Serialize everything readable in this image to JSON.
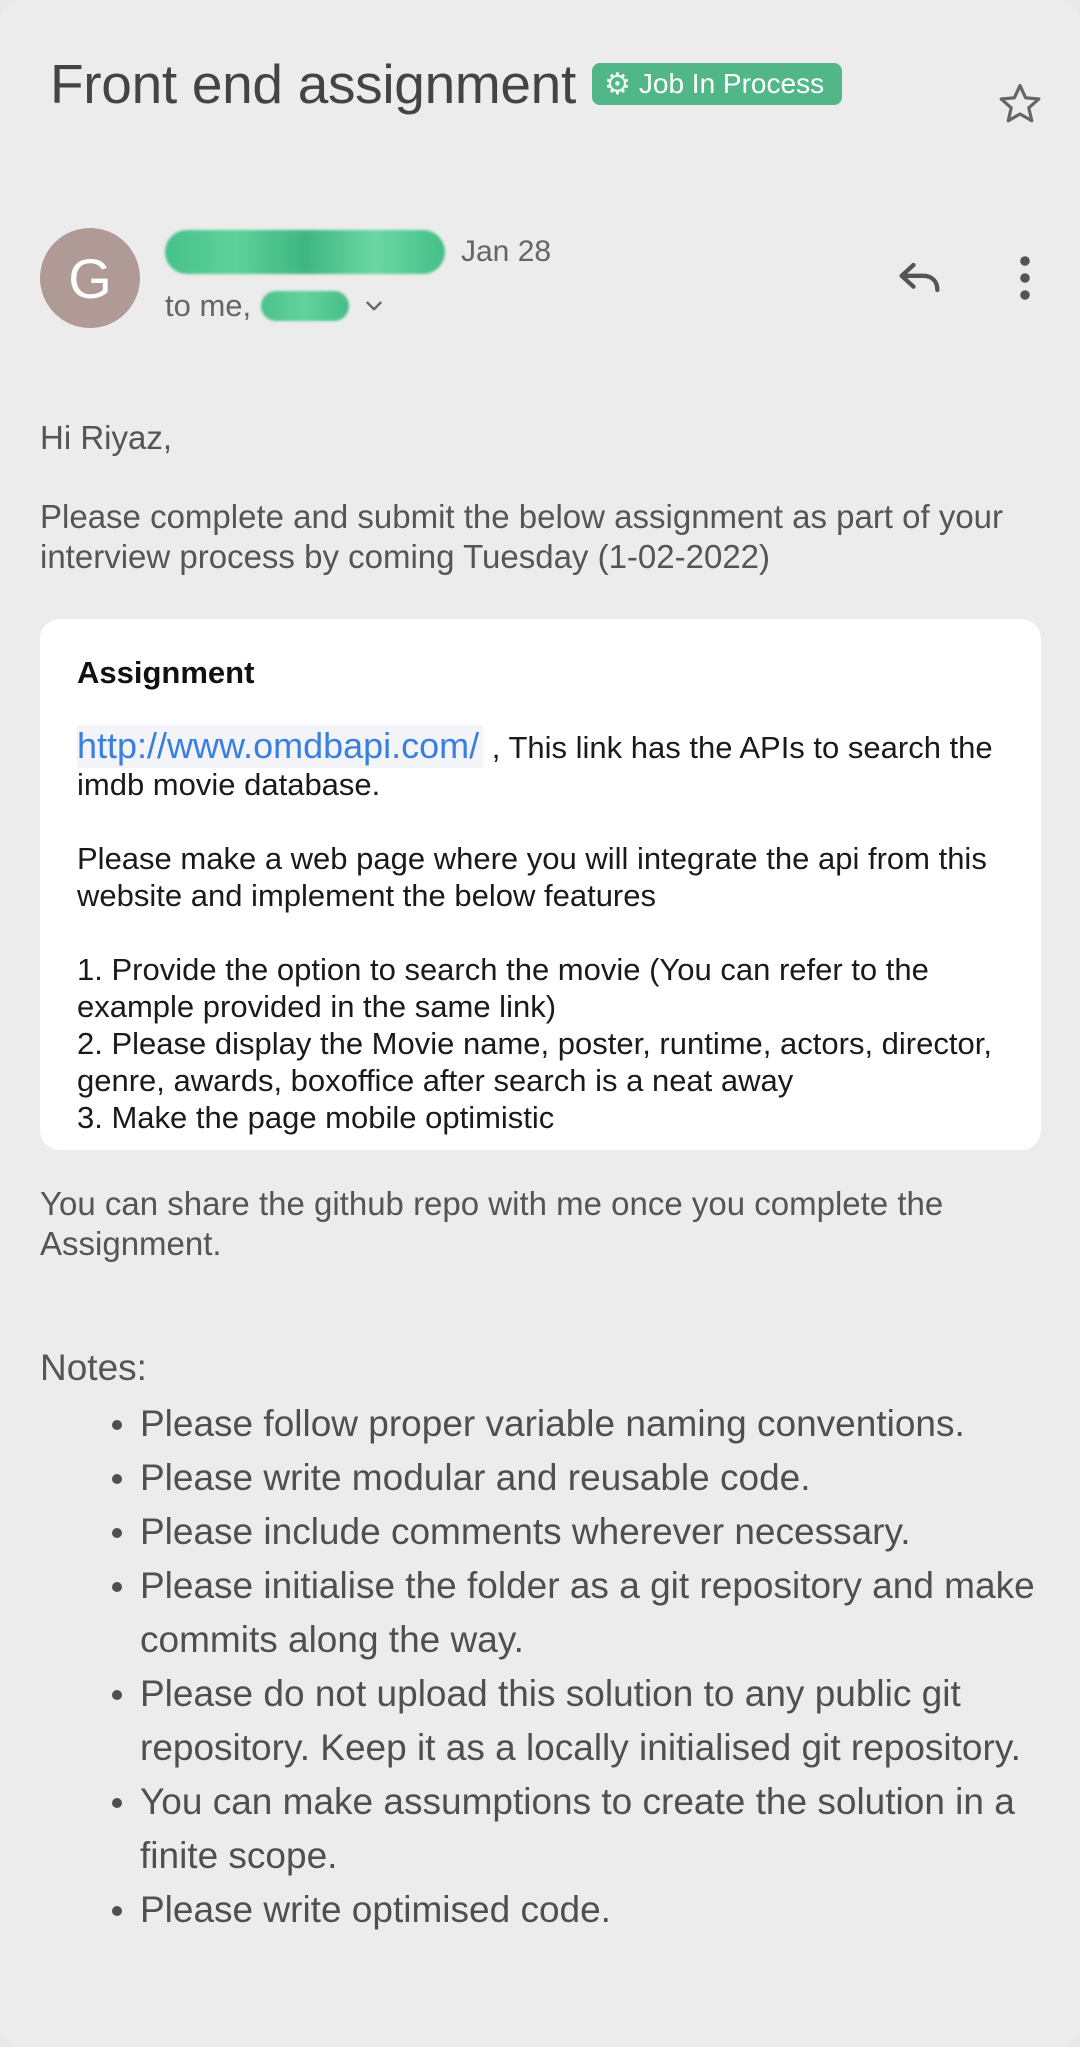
{
  "header": {
    "subject": "Front end assignment",
    "label": "Job In Process",
    "label_color": "#52b788"
  },
  "sender": {
    "avatar_letter": "G",
    "name": "",
    "date": "Jan 28",
    "recipients_prefix": "to me,",
    "recipients_name": ""
  },
  "message": {
    "greeting": "Hi Riyaz,",
    "intro": "Please complete and submit the below assignment as part of your interview process by coming Tuesday (1-02-2022)",
    "card": {
      "title": "Assignment",
      "link_text": "http://www.omdbapi.com/",
      "link_suffix": " , This link has the APIs to search the imdb movie database.",
      "instruction": "Please make a web page where you will integrate the api from this website and implement the below features",
      "features": [
        "1. Provide the option to search the movie (You can refer to the example provided in the same link)",
        "2. Please display the Movie name, poster, runtime, actors, director, genre, awards, boxoffice after search is a neat away",
        "3. Make the page mobile optimistic"
      ]
    },
    "outro": "You can share the github repo with me once you complete the Assignment.",
    "notes_title": "Notes:",
    "notes": [
      "Please follow proper variable naming conventions.",
      "Please write modular and reusable code.",
      "Please include comments wherever necessary.",
      "Please initialise the folder as a git repository and make commits along the way.",
      "Please do not upload this solution to any public git repository. Keep it as a locally initialised git repository.",
      "You can make assumptions to create the solution in a finite scope.",
      "Please write optimised code."
    ]
  },
  "icons": {
    "star": "star-icon",
    "reply": "reply-icon",
    "more": "more-vert-icon",
    "chevron": "chevron-down-icon",
    "gear": "gear-icon"
  }
}
